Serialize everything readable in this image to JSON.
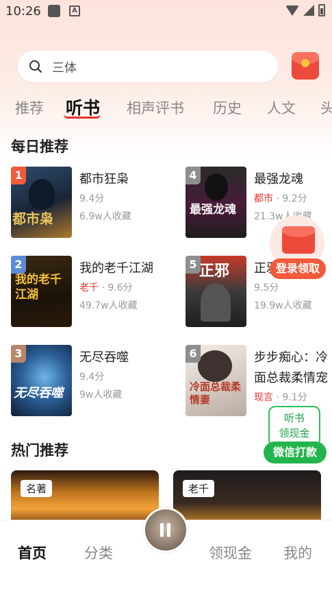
{
  "status_bar": {
    "time": "10:26"
  },
  "search": {
    "placeholder": "三体"
  },
  "tabs": [
    {
      "label": "推荐"
    },
    {
      "label": "听书"
    },
    {
      "label": "相声评书"
    },
    {
      "label": "历史"
    },
    {
      "label": "人文"
    },
    {
      "label": "头"
    }
  ],
  "active_tab": "听书",
  "daily": {
    "title": "每日推荐",
    "books": [
      {
        "rank": "1",
        "title": "都市狂枭",
        "tag": "",
        "score": "9.4分",
        "favorites": "6.9w人收藏",
        "rank_color": "#f05b3b"
      },
      {
        "rank": "4",
        "title": "最强龙魂",
        "tag": "都市",
        "score": "9.2分",
        "favorites": "21.3w人收藏",
        "rank_color": "#8e8e8e"
      },
      {
        "rank": "2",
        "title": "我的老千江湖",
        "tag": "老千",
        "score": "9.6分",
        "favorites": "49.7w人收藏",
        "rank_color": "#5b8bd9"
      },
      {
        "rank": "5",
        "title": "正邪",
        "tag": "",
        "score": "9.5分",
        "favorites": "19.9w人收藏",
        "rank_color": "#8e8e8e"
      },
      {
        "rank": "3",
        "title": "无尽吞噬",
        "tag": "",
        "score": "9.4分",
        "favorites": "9w人收藏",
        "rank_color": "#b8866a"
      },
      {
        "rank": "6",
        "title": "步步痴心：冷",
        "title_line2": "面总裁柔情宠",
        "tag": "现言",
        "score": "9.1分",
        "favorites": "",
        "rank_color": "#8e8e8e"
      }
    ],
    "cover_texts": [
      "都市枭",
      "最强龙魂",
      "我的老千江湖",
      "正邪",
      "无尽吞噬",
      "冷面总裁柔情妻"
    ]
  },
  "hot": {
    "title": "热门推荐",
    "cards": [
      {
        "tag": "名著"
      },
      {
        "tag": "老千"
      }
    ]
  },
  "floating": {
    "login_label": "登录领取",
    "listen_line1": "听书",
    "listen_line2": "领现金",
    "wechat_label": "微信打款"
  },
  "nav": [
    {
      "label": "首页"
    },
    {
      "label": "分类"
    },
    {
      "label": "领现金"
    },
    {
      "label": "我的"
    }
  ],
  "colors": {
    "accent": "#e9322b",
    "wechat_green": "#23b44d"
  }
}
